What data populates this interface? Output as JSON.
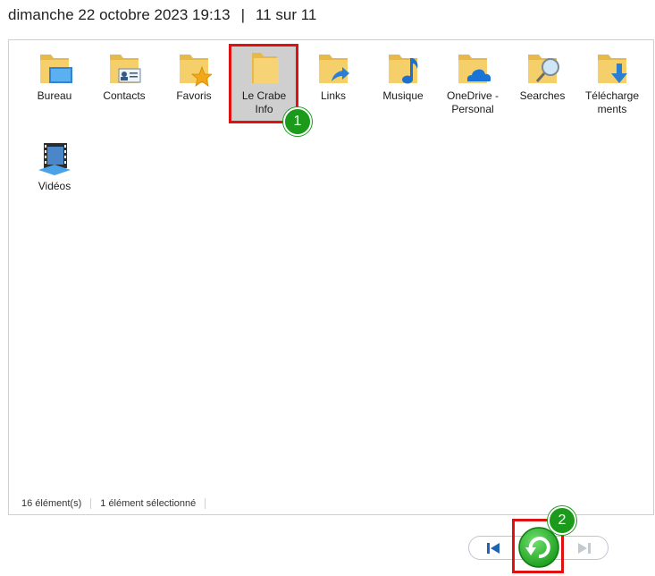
{
  "header": {
    "datetime": "dimanche 22 octobre 2023 19:13",
    "separator": "|",
    "position": "11 sur 11"
  },
  "items": [
    {
      "name": "Bureau",
      "icon": "folder-desktop-icon",
      "selected": false
    },
    {
      "name": "Contacts",
      "icon": "folder-contacts-icon",
      "selected": false
    },
    {
      "name": "Favoris",
      "icon": "folder-favorites-icon",
      "selected": false
    },
    {
      "name": "Le Crabe Info",
      "icon": "folder-icon",
      "selected": true
    },
    {
      "name": "Links",
      "icon": "folder-links-icon",
      "selected": false
    },
    {
      "name": "Musique",
      "icon": "folder-music-icon",
      "selected": false
    },
    {
      "name": "OneDrive - Personal",
      "icon": "folder-onedrive-icon",
      "selected": false
    },
    {
      "name": "Searches",
      "icon": "folder-searches-icon",
      "selected": false
    },
    {
      "name": "Téléchargements",
      "icon": "folder-downloads-icon",
      "selected": false
    },
    {
      "name": "Vidéos",
      "icon": "folder-videos-icon",
      "selected": false
    }
  ],
  "labels": {
    "le_crabe": "Le Crabe Info",
    "onedrive": "OneDrive - Personal",
    "telecharge_a": "Télécharge",
    "telecharge_b": "ments"
  },
  "status": {
    "count": "16 élément(s)",
    "selection": "1 élément sélectionné"
  },
  "annotations": {
    "badge1": "1",
    "badge2": "2"
  },
  "colors": {
    "highlight": "#e01111",
    "badge": "#1c9a1c",
    "folder": "#f4cf6a",
    "selection": "#cfcfcf"
  }
}
